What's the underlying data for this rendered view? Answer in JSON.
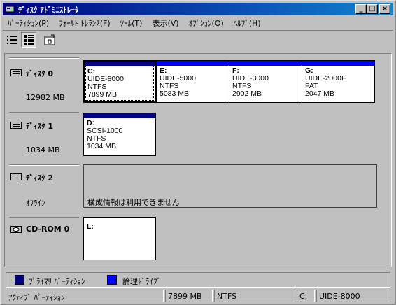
{
  "window": {
    "title": "ﾃﾞｨｽｸ ｱﾄﾞﾐﾆｽﾄﾚｰﾀ",
    "minimize_glyph": "_",
    "maximize_glyph": "□",
    "close_glyph": "×"
  },
  "menu": [
    "ﾊﾟｰﾃｨｼｮﾝ(P)",
    "ﾌｫｰﾙﾄ ﾄﾚﾗﾝｽ(F)",
    "ﾂｰﾙ(T)",
    "表示(V)",
    "ｵﾌﾟｼｮﾝ(O)",
    "ﾍﾙﾌﾟ(H)"
  ],
  "toolbar": {
    "buttons": [
      {
        "icon": "volumes-view-icon"
      },
      {
        "icon": "disk-config-view-icon"
      },
      {
        "icon": "properties-icon"
      }
    ]
  },
  "colors": {
    "primary_partition": "#000080",
    "logical_drive": "#0000ff"
  },
  "disks": [
    {
      "name": "ﾃﾞｨｽｸ 0",
      "size": "12982 MB",
      "partitions": [
        {
          "letter": "C:",
          "label": "UIDE-8000",
          "fs": "NTFS",
          "size": "7899 MB",
          "type": "primary",
          "selected": true
        },
        {
          "letter": "E:",
          "label": "UIDE-5000",
          "fs": "NTFS",
          "size": "5083 MB",
          "type": "logical"
        },
        {
          "letter": "F:",
          "label": "UIDE-3000",
          "fs": "NTFS",
          "size": "2902 MB",
          "type": "logical"
        },
        {
          "letter": "G:",
          "label": "UIDE-2000F",
          "fs": "FAT",
          "size": "2047 MB",
          "type": "logical"
        }
      ]
    },
    {
      "name": "ﾃﾞｨｽｸ 1",
      "size": "1034 MB",
      "partitions": [
        {
          "letter": "D:",
          "label": "SCSI-1000",
          "fs": "NTFS",
          "size": "1034 MB",
          "type": "primary"
        }
      ]
    },
    {
      "name": "ﾃﾞｨｽｸ 2",
      "size": "ｵﾌﾗｲﾝ",
      "message": "構成情報は利用できません"
    },
    {
      "name": "CD-ROM 0",
      "partitions": [
        {
          "letter": "L:"
        }
      ]
    }
  ],
  "legend": [
    {
      "label": "ﾌﾟﾗｲﾏﾘ ﾊﾟｰﾃｨｼｮﾝ"
    },
    {
      "label": "論理ﾄﾞﾗｲﾌﾞ"
    }
  ],
  "status": {
    "type": "ｱｸﾃｨﾌﾞ ﾊﾟｰﾃｨｼｮﾝ",
    "size": "7899 MB",
    "fs": "NTFS",
    "drive": "C:",
    "label": "UIDE-8000"
  }
}
